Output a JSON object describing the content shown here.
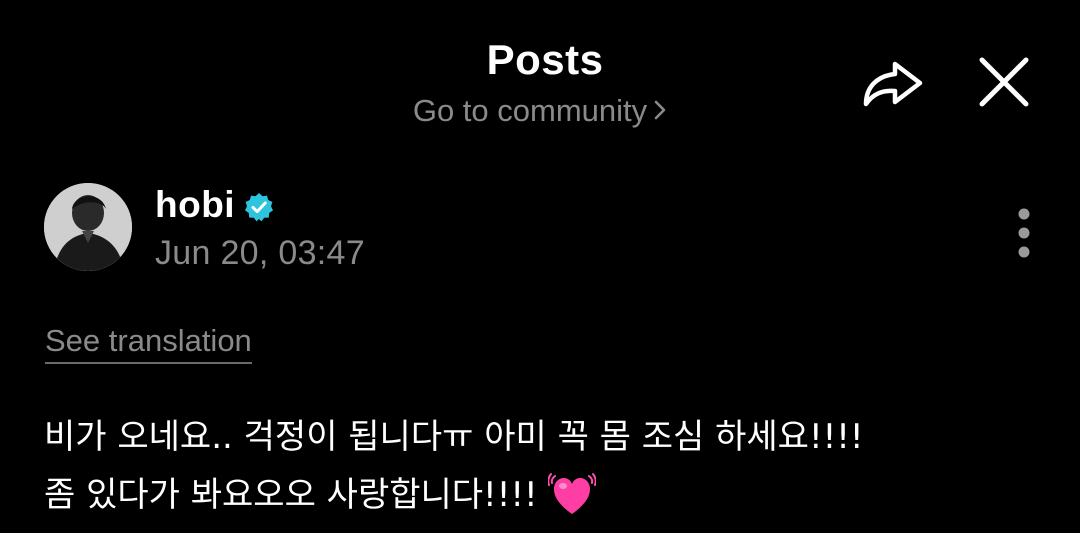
{
  "header": {
    "title": "Posts",
    "community_link": "Go to community",
    "share_icon": "share-arrow-icon",
    "close_icon": "close-icon"
  },
  "post": {
    "author": "hobi",
    "verified_badge": "verified-check-icon",
    "date": "Jun 20, 03:47",
    "more_icon": "more-vertical-icon",
    "see_translation": "See translation",
    "body_lines": [
      "비가 오네요.. 걱정이 됩니다ㅠ 아미 꼭 몸 조심 하세요!!!!",
      "좀 있다가 봐요오오 사랑합니다!!!!"
    ],
    "emoji": "beating-heart-emoji"
  },
  "colors": {
    "background": "#000000",
    "text_primary": "#ffffff",
    "text_secondary": "#8a8a8a",
    "verified": "#2ec4dd",
    "heart": "#ff3ea5"
  }
}
